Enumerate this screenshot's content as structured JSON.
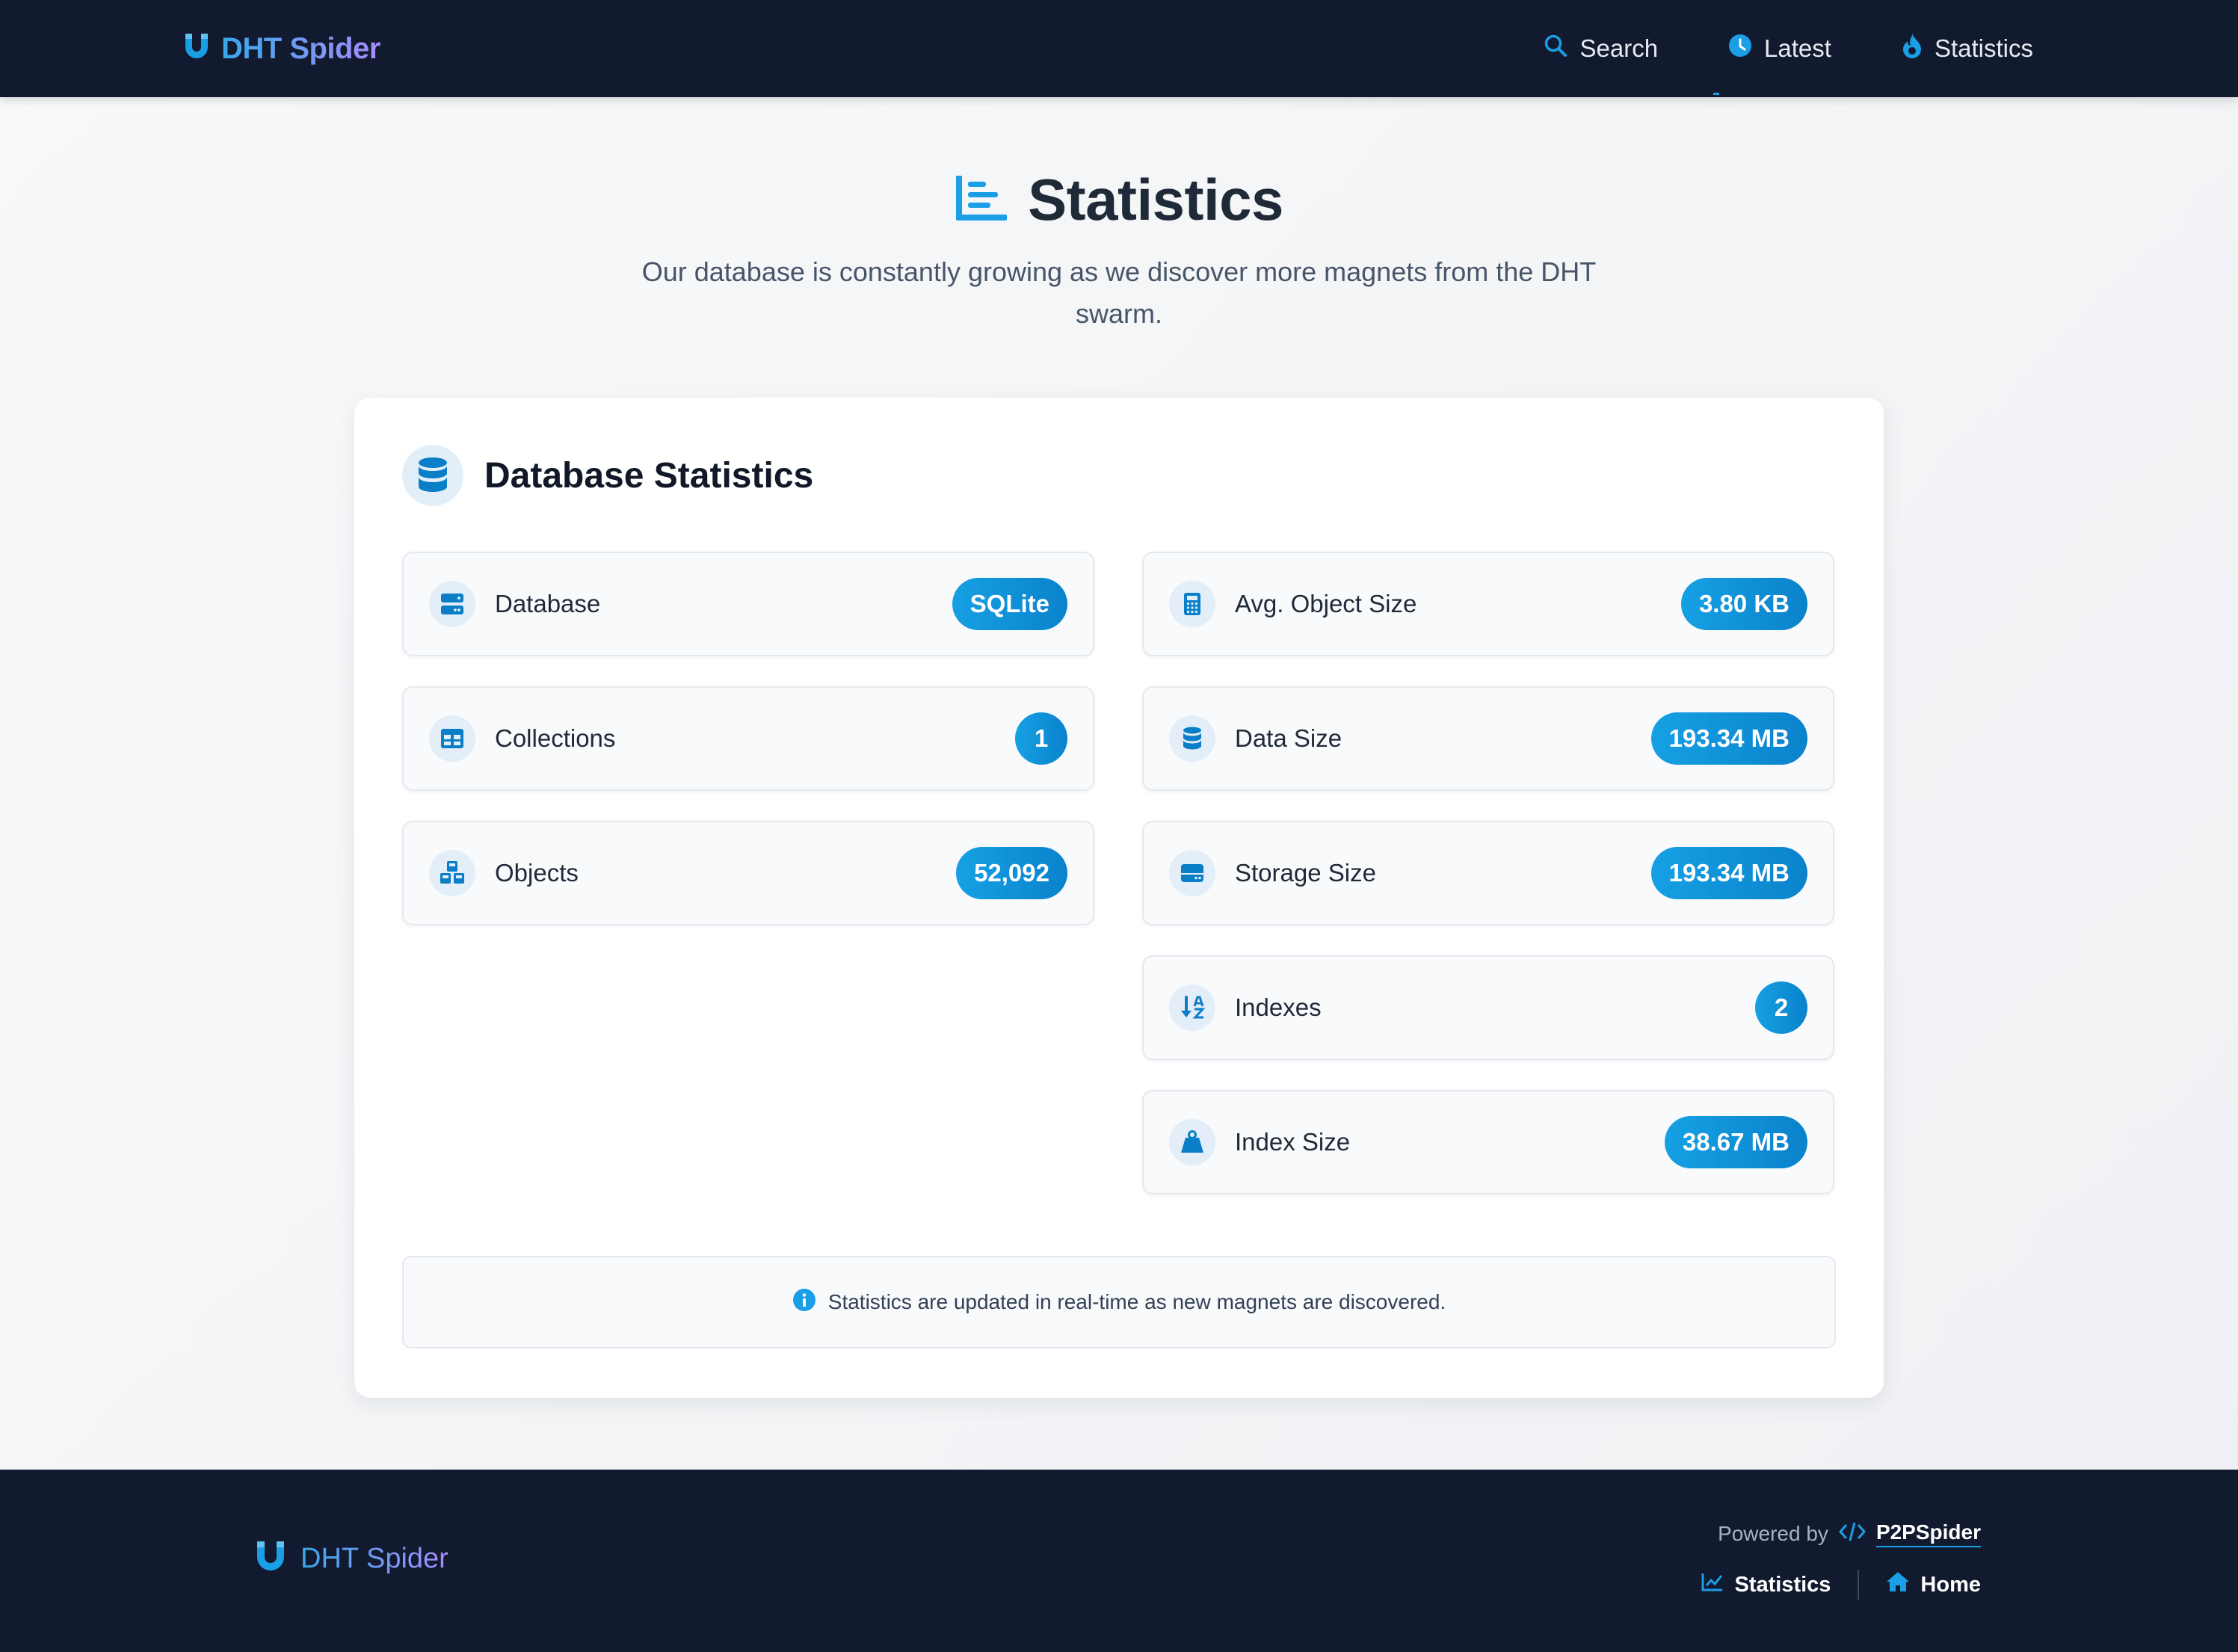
{
  "header": {
    "brand": "DHT Spider",
    "nav": [
      {
        "label": "Search",
        "icon": "search-icon"
      },
      {
        "label": "Latest",
        "icon": "clock-icon"
      },
      {
        "label": "Statistics",
        "icon": "fire-icon"
      }
    ]
  },
  "hero": {
    "title": "Statistics",
    "subtitle": "Our database is constantly growing as we discover more magnets from the DHT swarm."
  },
  "card": {
    "title": "Database Statistics",
    "left": [
      {
        "label": "Database",
        "value": "SQLite",
        "icon": "server-icon"
      },
      {
        "label": "Collections",
        "value": "1",
        "icon": "table-icon"
      },
      {
        "label": "Objects",
        "value": "52,092",
        "icon": "cubes-icon"
      }
    ],
    "right": [
      {
        "label": "Avg. Object Size",
        "value": "3.80 KB",
        "icon": "calculator-icon"
      },
      {
        "label": "Data Size",
        "value": "193.34 MB",
        "icon": "database-icon"
      },
      {
        "label": "Storage Size",
        "value": "193.34 MB",
        "icon": "hdd-icon"
      },
      {
        "label": "Indexes",
        "value": "2",
        "icon": "sort-icon"
      },
      {
        "label": "Index Size",
        "value": "38.67 MB",
        "icon": "weight-icon"
      }
    ],
    "note": "Statistics are updated in real-time as new magnets are discovered."
  },
  "footer": {
    "brand": "DHT Spider",
    "powered_by": "Powered by",
    "powered_name": "P2PSpider",
    "links": [
      {
        "label": "Statistics",
        "icon": "chart-line-icon"
      },
      {
        "label": "Home",
        "icon": "home-icon"
      }
    ]
  },
  "colors": {
    "accent": "#1a9ee6",
    "header_bg": "#111a2e",
    "pill": "#0e8fd6"
  }
}
